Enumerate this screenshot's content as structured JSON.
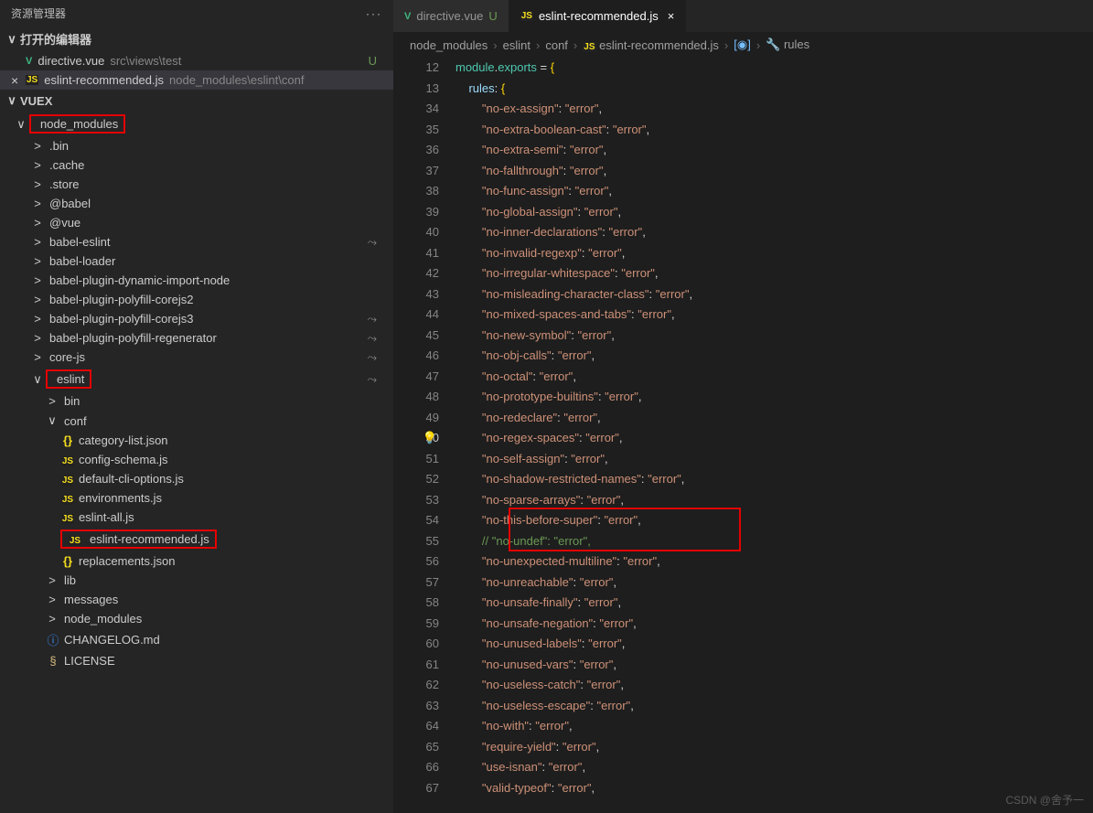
{
  "sidebar": {
    "title": "资源管理器",
    "openEditors": "打开的编辑器",
    "editors": [
      {
        "icon": "vue",
        "name": "directive.vue",
        "path": "src\\views\\test",
        "status": "U"
      },
      {
        "icon": "js",
        "name": "eslint-recommended.js",
        "path": "node_modules\\eslint\\conf",
        "close": true
      }
    ],
    "project": "VUEX",
    "tree": [
      {
        "d": 1,
        "chev": "∨",
        "label": "node_modules",
        "hl": true
      },
      {
        "d": 2,
        "chev": ">",
        "label": ".bin"
      },
      {
        "d": 2,
        "chev": ">",
        "label": ".cache"
      },
      {
        "d": 2,
        "chev": ">",
        "label": ".store"
      },
      {
        "d": 2,
        "chev": ">",
        "label": "@babel"
      },
      {
        "d": 2,
        "chev": ">",
        "label": "@vue"
      },
      {
        "d": 2,
        "chev": ">",
        "label": "babel-eslint",
        "git": "⤳"
      },
      {
        "d": 2,
        "chev": ">",
        "label": "babel-loader"
      },
      {
        "d": 2,
        "chev": ">",
        "label": "babel-plugin-dynamic-import-node"
      },
      {
        "d": 2,
        "chev": ">",
        "label": "babel-plugin-polyfill-corejs2"
      },
      {
        "d": 2,
        "chev": ">",
        "label": "babel-plugin-polyfill-corejs3",
        "git": "⤳"
      },
      {
        "d": 2,
        "chev": ">",
        "label": "babel-plugin-polyfill-regenerator",
        "git": "⤳"
      },
      {
        "d": 2,
        "chev": ">",
        "label": "core-js",
        "git": "⤳"
      },
      {
        "d": 2,
        "chev": "∨",
        "label": "eslint",
        "hl": true,
        "git": "⤳"
      },
      {
        "d": 3,
        "chev": ">",
        "label": "bin"
      },
      {
        "d": 3,
        "chev": "∨",
        "label": "conf"
      },
      {
        "d": 4,
        "icon": "json",
        "label": "category-list.json"
      },
      {
        "d": 4,
        "icon": "js",
        "label": "config-schema.js"
      },
      {
        "d": 4,
        "icon": "js",
        "label": "default-cli-options.js"
      },
      {
        "d": 4,
        "icon": "js",
        "label": "environments.js"
      },
      {
        "d": 4,
        "icon": "js",
        "label": "eslint-all.js"
      },
      {
        "d": 4,
        "icon": "js",
        "label": "eslint-recommended.js",
        "hl": true
      },
      {
        "d": 4,
        "icon": "json",
        "label": "replacements.json"
      },
      {
        "d": 3,
        "chev": ">",
        "label": "lib"
      },
      {
        "d": 3,
        "chev": ">",
        "label": "messages"
      },
      {
        "d": 3,
        "chev": ">",
        "label": "node_modules"
      },
      {
        "d": 3,
        "icon": "info",
        "label": "CHANGELOG.md"
      },
      {
        "d": 3,
        "icon": "lic",
        "label": "LICENSE"
      }
    ]
  },
  "tabs": [
    {
      "icon": "vue",
      "name": "directive.vue",
      "status": "U",
      "active": false
    },
    {
      "icon": "js",
      "name": "eslint-recommended.js",
      "close": "×",
      "active": true
    }
  ],
  "breadcrumbs": [
    "node_modules",
    "eslint",
    "conf",
    "eslint-recommended.js",
    "<unknown>",
    "rules"
  ],
  "code": {
    "start_lines": [
      12,
      13
    ],
    "body_start": 34,
    "lines": [
      {
        "n": 12,
        "t": "module",
        "v": ".",
        "v2": "exports",
        "op": " = ",
        "b": "{"
      },
      {
        "n": 13,
        "indent": 1,
        "t": "rules",
        "op": ": ",
        "b": "{"
      },
      {
        "n": 34,
        "indent": 2,
        "k": "no-ex-assign",
        "val": "error"
      },
      {
        "n": 35,
        "indent": 2,
        "k": "no-extra-boolean-cast",
        "val": "error"
      },
      {
        "n": 36,
        "indent": 2,
        "k": "no-extra-semi",
        "val": "error"
      },
      {
        "n": 37,
        "indent": 2,
        "k": "no-fallthrough",
        "val": "error"
      },
      {
        "n": 38,
        "indent": 2,
        "k": "no-func-assign",
        "val": "error"
      },
      {
        "n": 39,
        "indent": 2,
        "k": "no-global-assign",
        "val": "error"
      },
      {
        "n": 40,
        "indent": 2,
        "k": "no-inner-declarations",
        "val": "error"
      },
      {
        "n": 41,
        "indent": 2,
        "k": "no-invalid-regexp",
        "val": "error"
      },
      {
        "n": 42,
        "indent": 2,
        "k": "no-irregular-whitespace",
        "val": "error"
      },
      {
        "n": 43,
        "indent": 2,
        "k": "no-misleading-character-class",
        "val": "error"
      },
      {
        "n": 44,
        "indent": 2,
        "k": "no-mixed-spaces-and-tabs",
        "val": "error"
      },
      {
        "n": 45,
        "indent": 2,
        "k": "no-new-symbol",
        "val": "error"
      },
      {
        "n": 46,
        "indent": 2,
        "k": "no-obj-calls",
        "val": "error"
      },
      {
        "n": 47,
        "indent": 2,
        "k": "no-octal",
        "val": "error"
      },
      {
        "n": 48,
        "indent": 2,
        "k": "no-prototype-builtins",
        "val": "error"
      },
      {
        "n": 49,
        "indent": 2,
        "k": "no-redeclare",
        "val": "error"
      },
      {
        "n": 50,
        "indent": 2,
        "k": "no-regex-spaces",
        "val": "error",
        "cur": true,
        "bulb": true
      },
      {
        "n": 51,
        "indent": 2,
        "k": "no-self-assign",
        "val": "error"
      },
      {
        "n": 52,
        "indent": 2,
        "k": "no-shadow-restricted-names",
        "val": "error"
      },
      {
        "n": 53,
        "indent": 2,
        "k": "no-sparse-arrays",
        "val": "error"
      },
      {
        "n": 54,
        "indent": 2,
        "k": "no-this-before-super",
        "val": "error"
      },
      {
        "n": 55,
        "indent": 2,
        "comment": "// \"no-undef\": \"error\",",
        "hl": true
      },
      {
        "n": 56,
        "indent": 2,
        "k": "no-unexpected-multiline",
        "val": "error"
      },
      {
        "n": 57,
        "indent": 2,
        "k": "no-unreachable",
        "val": "error"
      },
      {
        "n": 58,
        "indent": 2,
        "k": "no-unsafe-finally",
        "val": "error"
      },
      {
        "n": 59,
        "indent": 2,
        "k": "no-unsafe-negation",
        "val": "error"
      },
      {
        "n": 60,
        "indent": 2,
        "k": "no-unused-labels",
        "val": "error"
      },
      {
        "n": 61,
        "indent": 2,
        "k": "no-unused-vars",
        "val": "error"
      },
      {
        "n": 62,
        "indent": 2,
        "k": "no-useless-catch",
        "val": "error"
      },
      {
        "n": 63,
        "indent": 2,
        "k": "no-useless-escape",
        "val": "error"
      },
      {
        "n": 64,
        "indent": 2,
        "k": "no-with",
        "val": "error"
      },
      {
        "n": 65,
        "indent": 2,
        "k": "require-yield",
        "val": "error"
      },
      {
        "n": 66,
        "indent": 2,
        "k": "use-isnan",
        "val": "error"
      },
      {
        "n": 67,
        "indent": 2,
        "k": "valid-typeof",
        "val": "error"
      }
    ]
  },
  "watermark": "CSDN @舍予一"
}
